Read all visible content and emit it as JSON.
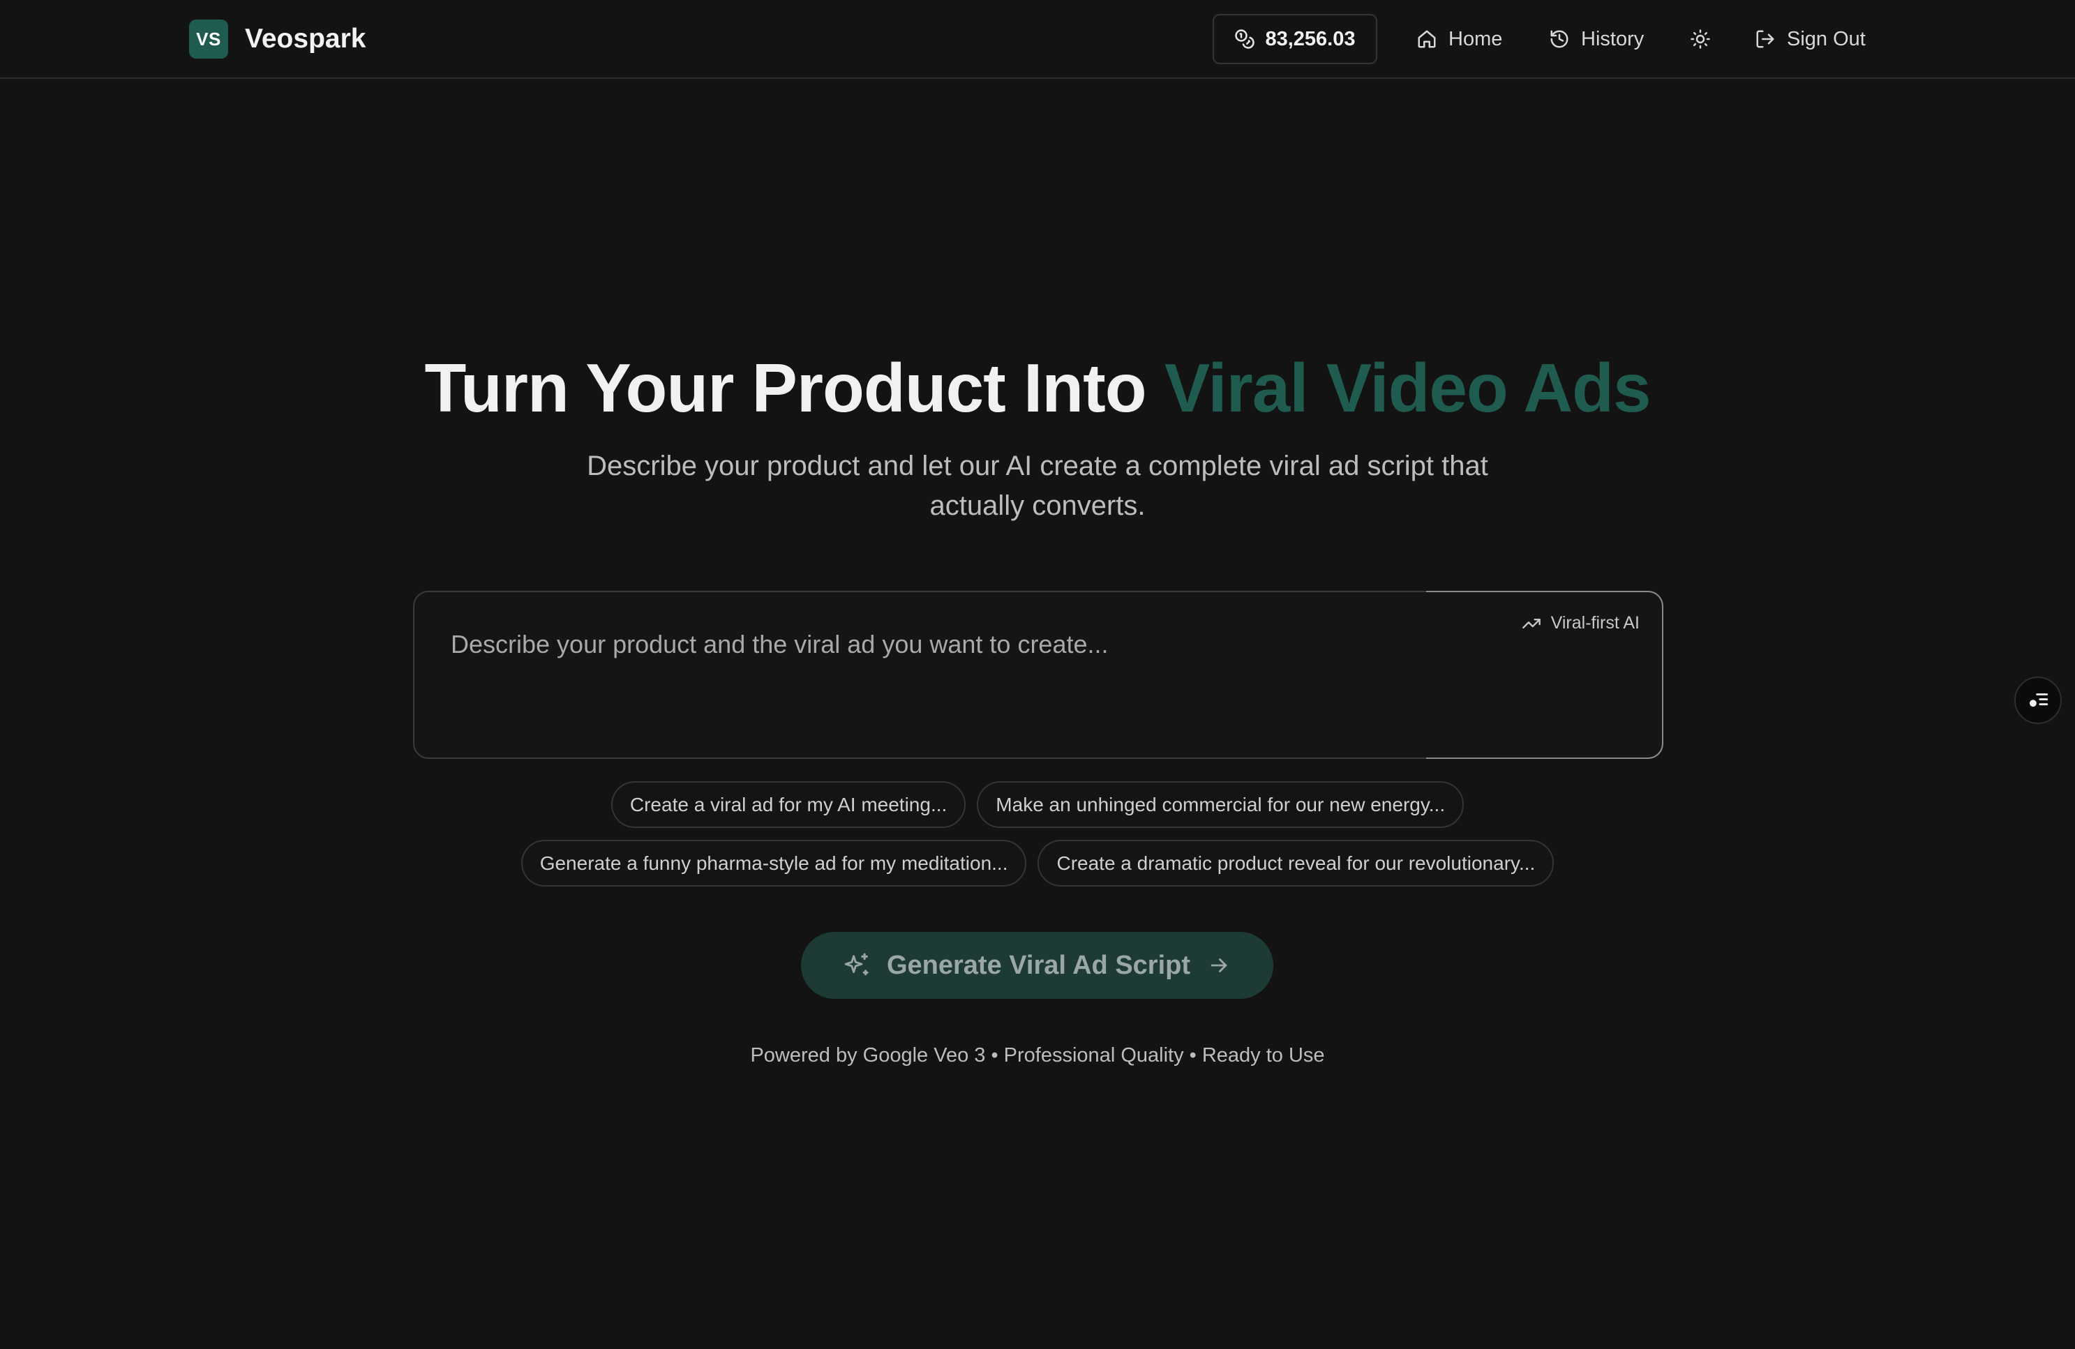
{
  "header": {
    "brand_badge": "VS",
    "brand_name": "Veospark",
    "credits": "83,256.03",
    "nav": {
      "home": "Home",
      "history": "History",
      "sign_out": "Sign Out"
    }
  },
  "hero": {
    "title_main": "Turn Your Product Into ",
    "title_accent": "Viral Video Ads",
    "subtitle": "Describe your product and let our AI create a complete viral ad script that actually converts."
  },
  "prompt": {
    "placeholder": "Describe your product and the viral ad you want to create...",
    "value": "",
    "tag": "Viral-first AI"
  },
  "suggestions": {
    "row1": [
      "Create a viral ad for my AI meeting...",
      "Make an unhinged commercial for our new energy..."
    ],
    "row2": [
      "Generate a funny pharma-style ad for my meditation...",
      "Create a dramatic product reveal for our revolutionary..."
    ]
  },
  "generate_button": "Generate Viral Ad Script",
  "footer_note": "Powered by Google Veo 3 • Professional Quality • Ready to Use",
  "colors": {
    "background": "#131313",
    "accent": "#1f5c4f",
    "button_bg": "#1d3a34"
  },
  "icons": {
    "credits": "coins-icon",
    "home": "home-icon",
    "history": "history-icon",
    "theme": "sun-icon",
    "sign_out": "sign-out-icon",
    "viral_tag": "trending-up-icon",
    "generate": "sparkles-icon",
    "generate_arrow": "arrow-right-icon",
    "side_fab": "list-settings-icon"
  }
}
